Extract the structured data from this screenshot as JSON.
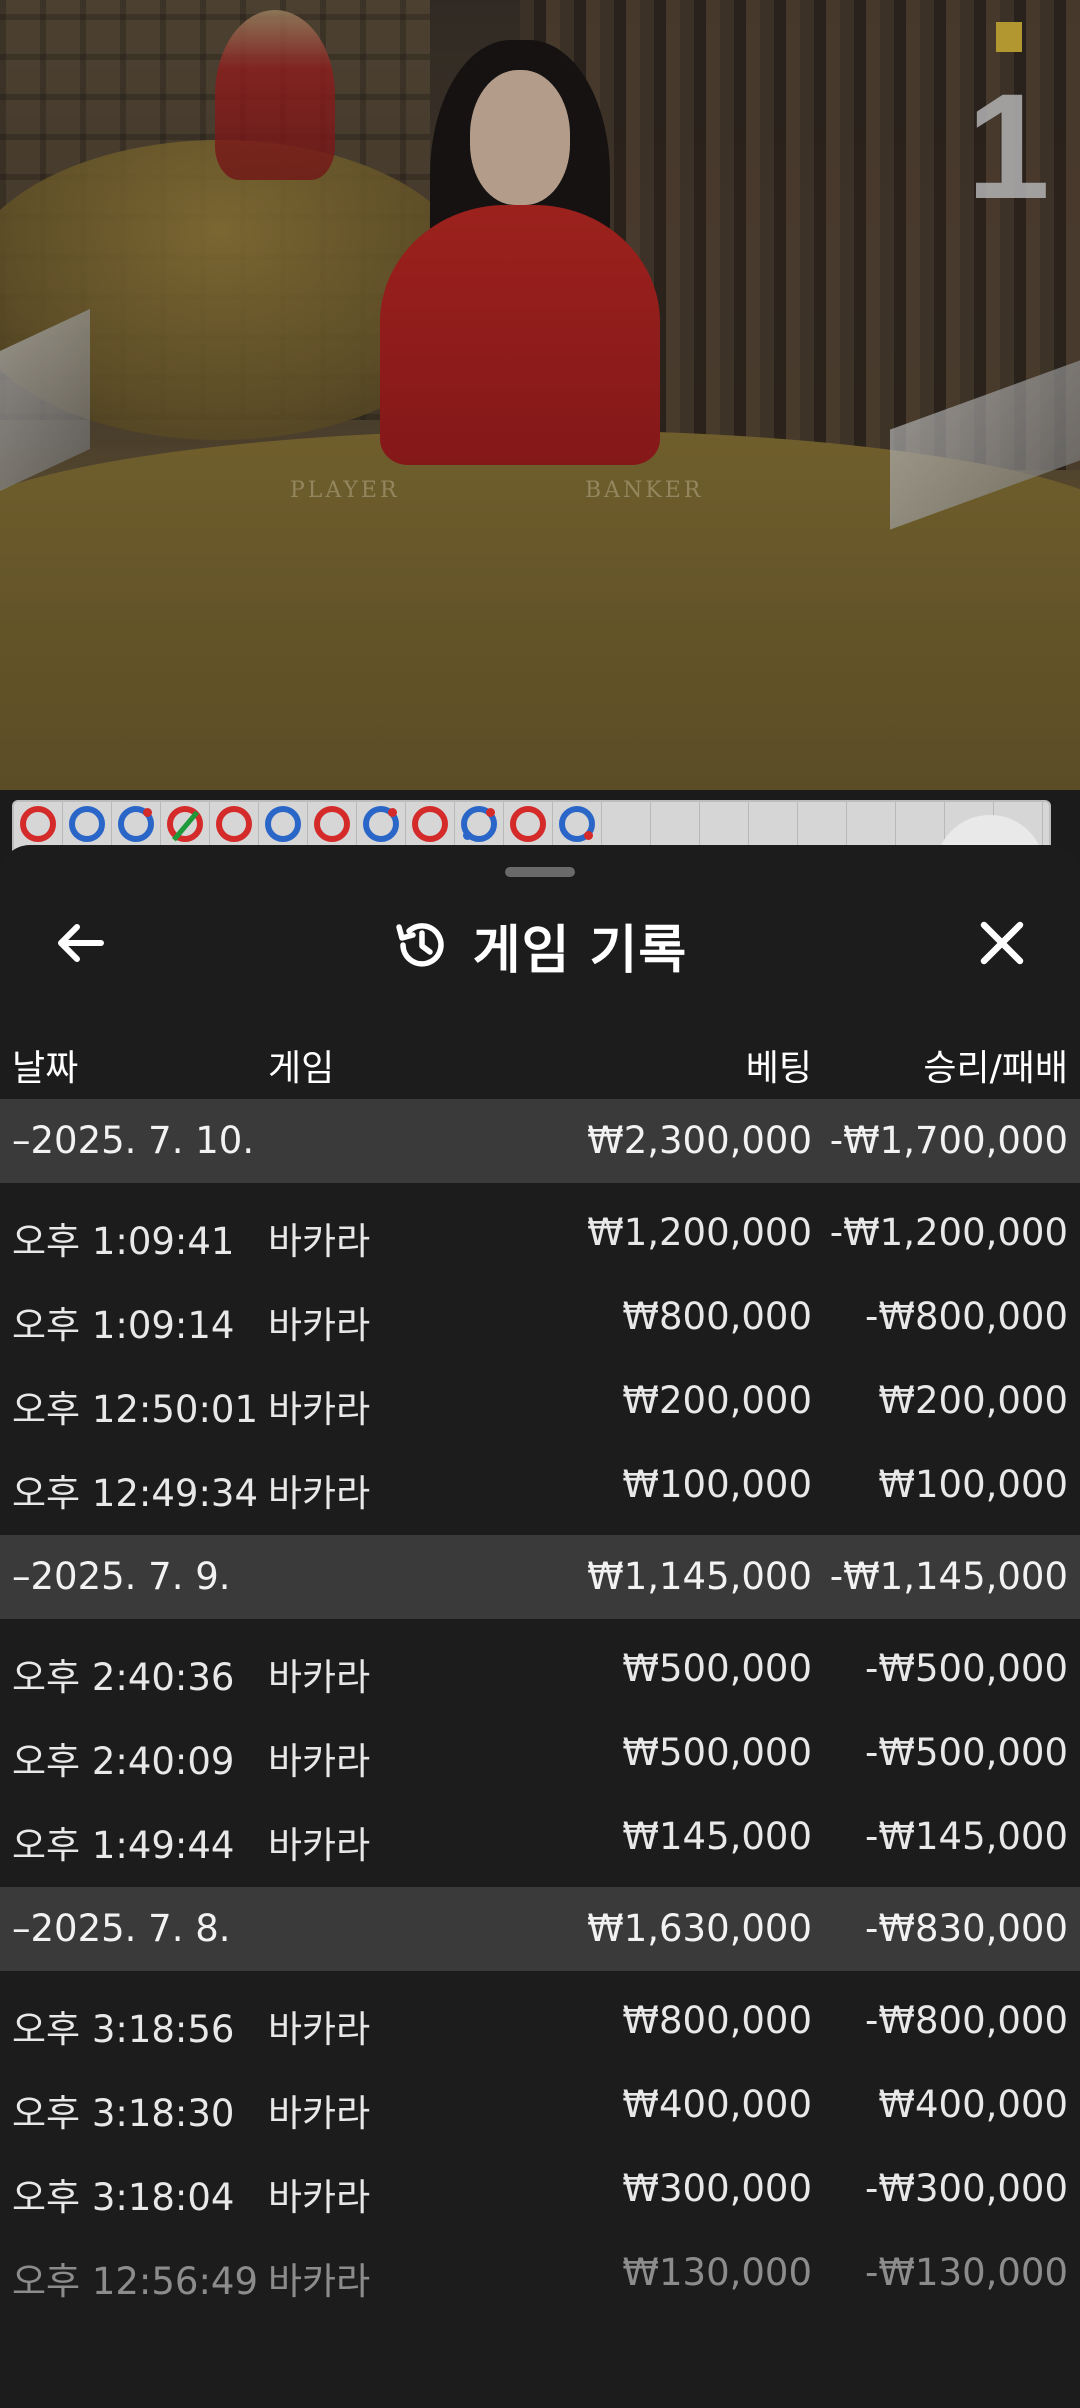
{
  "video": {
    "round_number": "1",
    "felt_player": "PLAYER",
    "felt_banker": "BANKER"
  },
  "roadmap": {
    "beads": [
      "banker",
      "player",
      "player",
      "tie",
      "banker",
      "player",
      "banker",
      "player",
      "banker",
      "player",
      "banker",
      "player"
    ]
  },
  "sheet": {
    "title": "게임 기록",
    "columns": {
      "date": "날짜",
      "game": "게임",
      "bet": "베팅",
      "win_loss": "승리/패배"
    },
    "groups": [
      {
        "date": "–2025. 7. 10.",
        "bet": "₩2,300,000",
        "win_loss": "-₩1,700,000",
        "rows": [
          {
            "time": "오후 1:09:41",
            "game": "바카라",
            "bet": "₩1,200,000",
            "win_loss": "-₩1,200,000"
          },
          {
            "time": "오후 1:09:14",
            "game": "바카라",
            "bet": "₩800,000",
            "win_loss": "-₩800,000"
          },
          {
            "time": "오후 12:50:01",
            "game": "바카라",
            "bet": "₩200,000",
            "win_loss": "₩200,000"
          },
          {
            "time": "오후 12:49:34",
            "game": "바카라",
            "bet": "₩100,000",
            "win_loss": "₩100,000"
          }
        ]
      },
      {
        "date": "–2025. 7. 9.",
        "bet": "₩1,145,000",
        "win_loss": "-₩1,145,000",
        "rows": [
          {
            "time": "오후 2:40:36",
            "game": "바카라",
            "bet": "₩500,000",
            "win_loss": "-₩500,000"
          },
          {
            "time": "오후 2:40:09",
            "game": "바카라",
            "bet": "₩500,000",
            "win_loss": "-₩500,000"
          },
          {
            "time": "오후 1:49:44",
            "game": "바카라",
            "bet": "₩145,000",
            "win_loss": "-₩145,000"
          }
        ]
      },
      {
        "date": "–2025. 7. 8.",
        "bet": "₩1,630,000",
        "win_loss": "-₩830,000",
        "rows": [
          {
            "time": "오후 3:18:56",
            "game": "바카라",
            "bet": "₩800,000",
            "win_loss": "-₩800,000"
          },
          {
            "time": "오후 3:18:30",
            "game": "바카라",
            "bet": "₩400,000",
            "win_loss": "₩400,000"
          },
          {
            "time": "오후 3:18:04",
            "game": "바카라",
            "bet": "₩300,000",
            "win_loss": "-₩300,000"
          },
          {
            "time": "오후 12:56:49",
            "game": "바카라",
            "bet": "₩130,000",
            "win_loss": "-₩130,000"
          }
        ]
      }
    ]
  }
}
